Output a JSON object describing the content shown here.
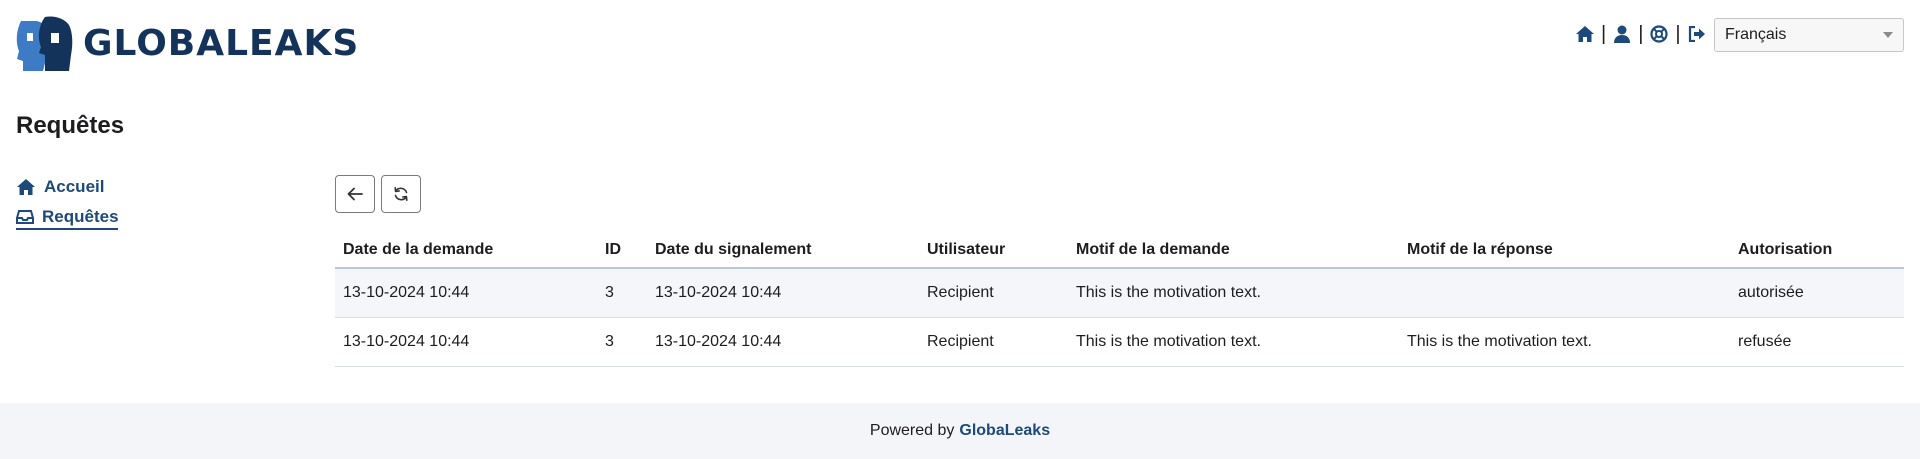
{
  "header": {
    "logo_text": "GLOBALEAKS",
    "icons": [
      "home-icon",
      "user-icon",
      "support-icon",
      "logout-icon"
    ],
    "separator": "|",
    "language": "Français"
  },
  "page": {
    "title": "Requêtes"
  },
  "sidebar": {
    "items": [
      {
        "label": "Accueil",
        "icon": "home-icon"
      },
      {
        "label": "Requêtes",
        "icon": "inbox-icon"
      }
    ]
  },
  "toolbar": {
    "buttons": [
      "back-arrow-icon",
      "refresh-icon"
    ]
  },
  "table": {
    "headers": [
      "Date de la demande",
      "ID",
      "Date du signalement",
      "Utilisateur",
      "Motif de la demande",
      "Motif de la réponse",
      "Autorisation"
    ],
    "rows": [
      [
        "13-10-2024 10:44",
        "3",
        "13-10-2024 10:44",
        "Recipient",
        "This is the motivation text.",
        "",
        "autorisée"
      ],
      [
        "13-10-2024 10:44",
        "3",
        "13-10-2024 10:44",
        "Recipient",
        "This is the motivation text.",
        "This is the motivation text.",
        "refusée"
      ]
    ]
  },
  "footer": {
    "prefix": "Powered by",
    "brand": "GlobaLeaks"
  },
  "colors": {
    "brand_dark": "#13335a",
    "link": "#1d4a7a",
    "logo_light_blue": "#3d7bc4"
  }
}
